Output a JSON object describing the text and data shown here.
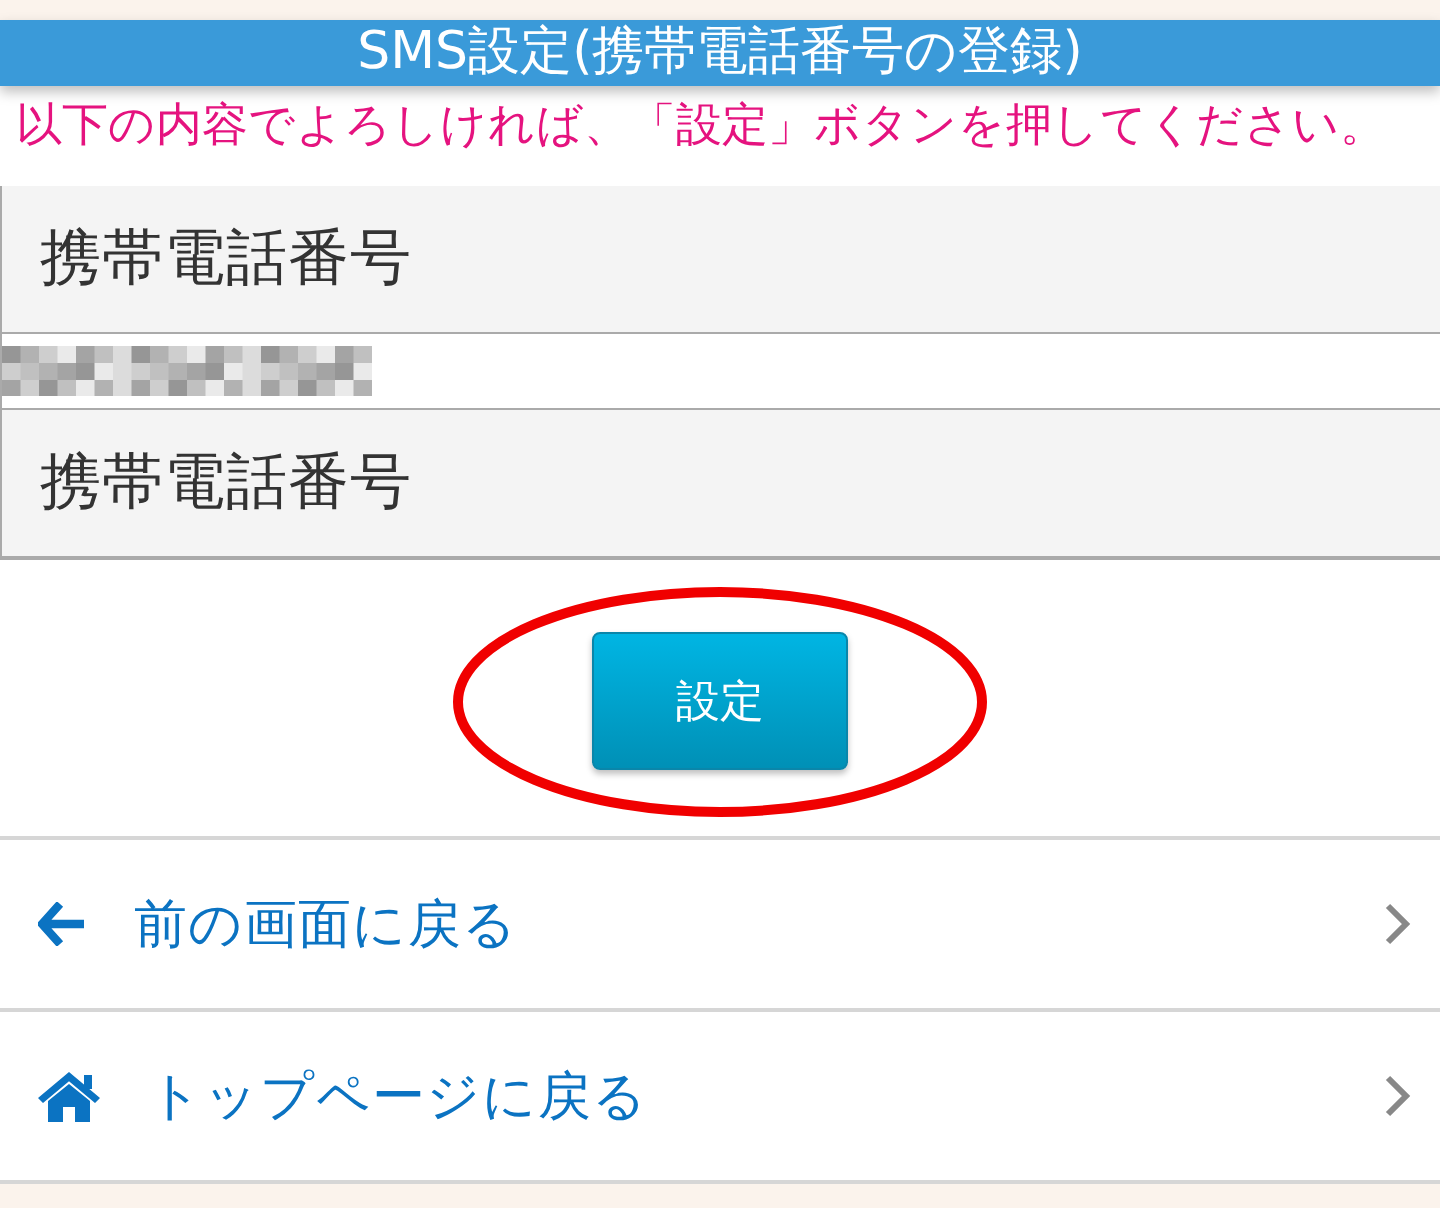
{
  "header": {
    "title": "SMS設定(携帯電話番号の登録)"
  },
  "message": "以下の内容でよろしければ、「設定」ボタンを押してください。",
  "form_rows": [
    {
      "kind": "heading",
      "text": "携帯電話番号"
    },
    {
      "kind": "masked_value"
    },
    {
      "kind": "heading",
      "text": "携帯電話番号"
    }
  ],
  "submit_button": {
    "label": "設定",
    "circled": true
  },
  "nav_links": [
    {
      "kind": "back",
      "label": "前の画面に戻る"
    },
    {
      "kind": "home",
      "label": "トップページに戻る"
    }
  ]
}
